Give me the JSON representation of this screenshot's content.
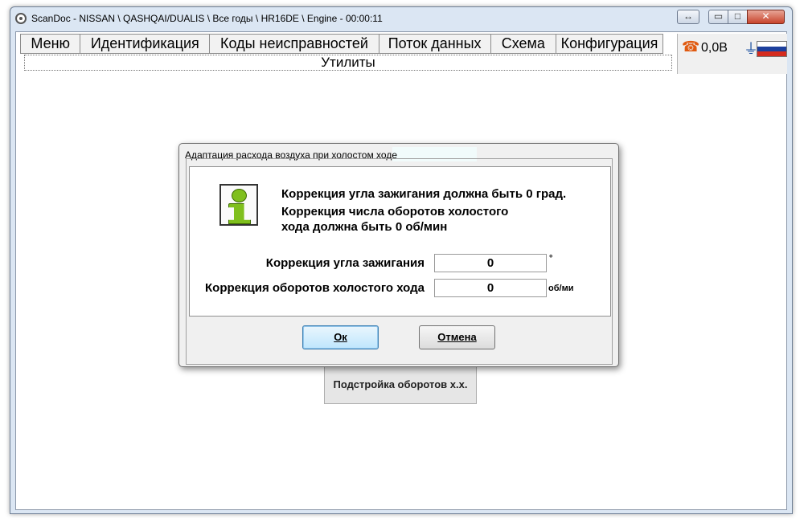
{
  "window": {
    "title": "ScanDoc - NISSAN \\ QASHQAI/DUALIS \\ Все годы \\ HR16DE \\ Engine - 00:00:11",
    "swap_icon": "↔",
    "minimize_icon": "▭",
    "maximize_icon": "□",
    "close_icon": "✕"
  },
  "menu": {
    "items": [
      "Меню",
      "Идентификация",
      "Коды неисправностей",
      "Поток данных",
      "Схема",
      "Конфигурация"
    ]
  },
  "status": {
    "phone_icon": "☎",
    "voltage": "0,0В",
    "plug_icon": "⏚",
    "flag": "russian-flag"
  },
  "utilities_label": "Утилиты",
  "background_button": "Подстройка оборотов х.х.",
  "dialog": {
    "title": "Адаптация расхода воздуха при холостом ходе",
    "message_line1": "Коррекция угла зажигания должна быть 0 град.",
    "message_line2": "Коррекция числа оборотов холостого",
    "message_line3": "хода должна быть 0 об/мин",
    "ignition_label": "Коррекция угла зажигания",
    "ignition_value": "0",
    "ignition_unit": "°",
    "idle_label": "Коррекция оборотов холостого хода",
    "idle_value": "0",
    "idle_unit": "об/ми",
    "ok_label": "Ок",
    "cancel_label": "Отмена"
  },
  "colors": {
    "accent": "#3c7fb1",
    "info_icon_green": "#7fbf1d",
    "phone_orange": "#e05a10",
    "close_red": "#c8442c"
  }
}
